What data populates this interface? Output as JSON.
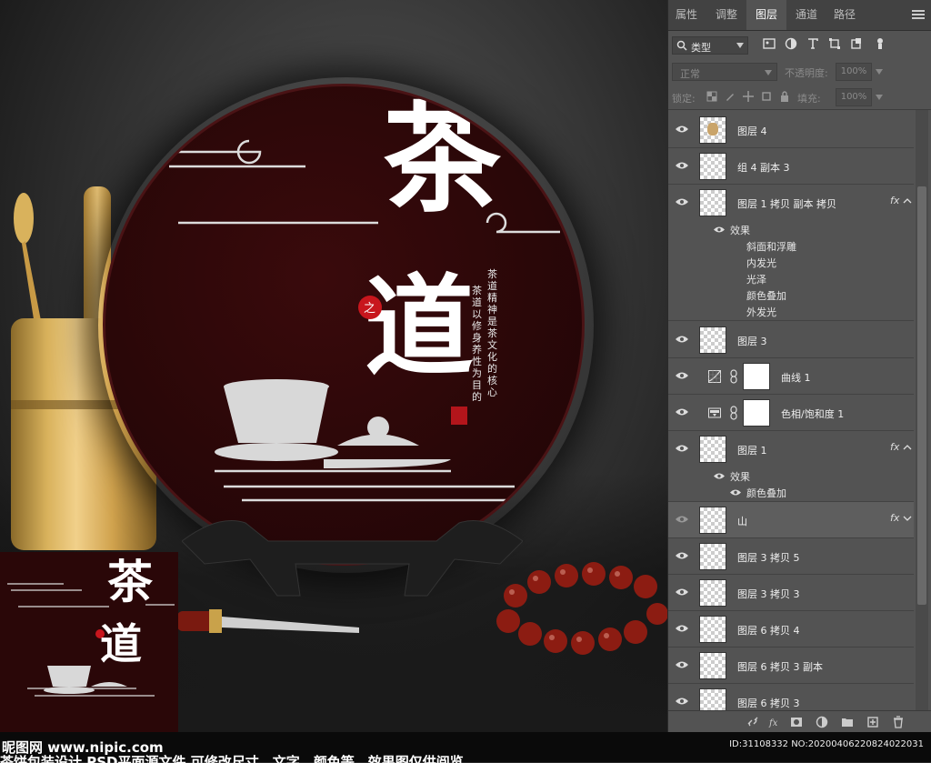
{
  "panel": {
    "tabs": [
      {
        "label": "属性"
      },
      {
        "label": "调整"
      },
      {
        "label": "图层"
      },
      {
        "label": "通道"
      },
      {
        "label": "路径"
      }
    ],
    "filter_label": "类型",
    "blend_mode": "正常",
    "opacity_label": "不透明度:",
    "opacity_value": "100%",
    "lock_label": "锁定:",
    "fill_label": "填充:",
    "fill_value": "100%",
    "layers": [
      {
        "name": "图层 4"
      },
      {
        "name": "组 4 副本 3"
      },
      {
        "name": "图层 1 拷贝 副本 拷贝",
        "fx": "fx",
        "effects_label": "效果",
        "effects": [
          "斜面和浮雕",
          "内发光",
          "光泽",
          "颜色叠加",
          "外发光"
        ]
      },
      {
        "name": "图层 3"
      },
      {
        "name": "曲线 1"
      },
      {
        "name": "色相/饱和度 1"
      },
      {
        "name": "图层 1",
        "fx": "fx",
        "effects_label": "效果",
        "effects": [
          "颜色叠加"
        ]
      },
      {
        "name": "山",
        "fx": "fx"
      },
      {
        "name": "图层 3 拷贝 5"
      },
      {
        "name": "图层 3 拷贝 3"
      },
      {
        "name": "图层 6 拷贝 4"
      },
      {
        "name": "图层 6 拷贝 3 副本"
      },
      {
        "name": "图层 6 拷贝 3"
      }
    ]
  },
  "artwork": {
    "title_char_1": "茶",
    "title_char_2": "道",
    "seal_char": "之",
    "poem_col_1": "茶道精神是茶文化的核心",
    "poem_col_2": "茶道以修身养性为目的"
  },
  "footer": {
    "site": "昵图网 www.nipic.com",
    "id": "ID:31108332 NO:20200406220824022031",
    "desc": "茶饼包装设计 PSD平面源文件 可修改尺寸、文字、颜色等，效果图仅供阅览"
  },
  "colors": {
    "panel_bg": "#535353",
    "plate": "#2a0708",
    "tab_bar": "#424242"
  }
}
